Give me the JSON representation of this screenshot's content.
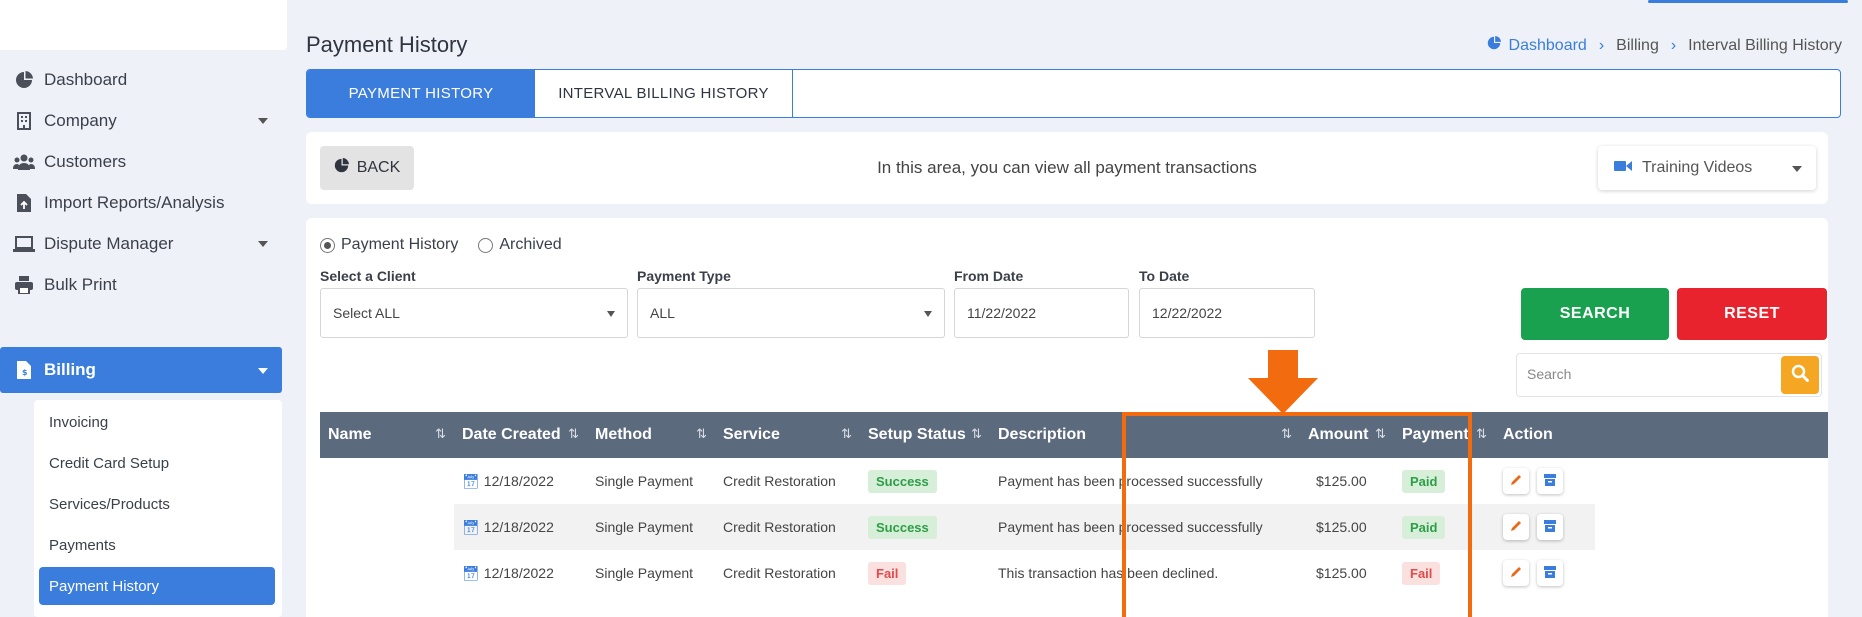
{
  "sidebar": {
    "items": [
      {
        "label": "Dashboard",
        "icon": "pie-chart-icon"
      },
      {
        "label": "Company",
        "icon": "building-icon"
      },
      {
        "label": "Customers",
        "icon": "users-icon"
      },
      {
        "label": "Import Reports/Analysis",
        "icon": "file-import-icon"
      },
      {
        "label": "Dispute Manager",
        "icon": "laptop-icon"
      },
      {
        "label": "Bulk Print",
        "icon": "printer-icon"
      },
      {
        "label": "Billing",
        "icon": "invoice-icon"
      }
    ],
    "submenu": [
      "Invoicing",
      "Credit Card Setup",
      "Services/Products",
      "Payments",
      "Payment History"
    ]
  },
  "header": {
    "title": "Payment History",
    "breadcrumb": [
      "Dashboard",
      "Billing",
      "Interval Billing History"
    ]
  },
  "tabs": [
    "PAYMENT HISTORY",
    "INTERVAL BILLING HISTORY"
  ],
  "info": {
    "back_label": "BACK",
    "text": "In this area, you can view all payment transactions",
    "training_label": "Training Videos"
  },
  "filters": {
    "radio": [
      "Payment History",
      "Archived"
    ],
    "client_label": "Select a Client",
    "client_value": "Select ALL",
    "type_label": "Payment Type",
    "type_value": "ALL",
    "from_label": "From Date",
    "from_value": "11/22/2022",
    "to_label": "To Date",
    "to_value": "12/22/2022",
    "search_btn": "SEARCH",
    "reset_btn": "RESET",
    "search_placeholder": "Search"
  },
  "table": {
    "headers": [
      "Name",
      "Date Created",
      "Method",
      "Service",
      "Setup Status",
      "Description",
      "Amount",
      "Payment",
      "Action"
    ],
    "rows": [
      {
        "name": "",
        "date": "12/18/2022",
        "method": "Single Payment",
        "service": "Credit Restoration",
        "status": "Success",
        "description": "Payment has been processed successfully",
        "amount": "$125.00",
        "payment": "Paid"
      },
      {
        "name": "",
        "date": "12/18/2022",
        "method": "Single Payment",
        "service": "Credit Restoration",
        "status": "Success",
        "description": "Payment has been processed successfully",
        "amount": "$125.00",
        "payment": "Paid"
      },
      {
        "name": "",
        "date": "12/18/2022",
        "method": "Single Payment",
        "service": "Credit Restoration",
        "status": "Fail",
        "description": "This transaction has been declined.",
        "amount": "$125.00",
        "payment": "Fail"
      }
    ]
  },
  "colors": {
    "primary": "#3b7ddd",
    "success": "#1aa14f",
    "danger": "#e8232d",
    "warning": "#f5a623",
    "table_header": "#5c6a7e",
    "annotation": "#f26b0f"
  }
}
